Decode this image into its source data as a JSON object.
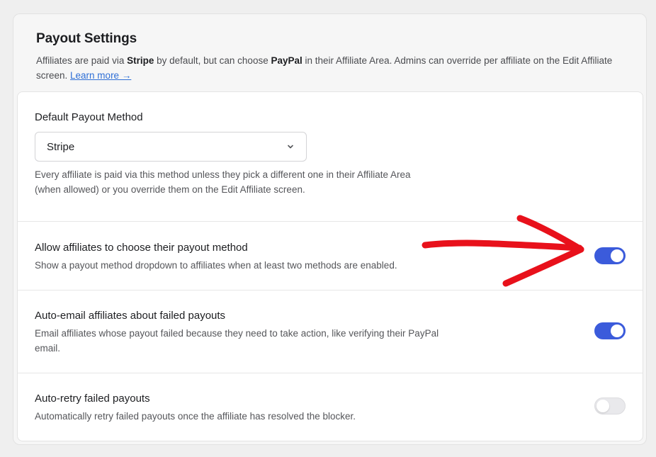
{
  "header": {
    "title": "Payout Settings",
    "desc_1": "Affiliates are paid via ",
    "desc_stripe": "Stripe",
    "desc_2": " by default, but can choose ",
    "desc_paypal": "PayPal",
    "desc_3": " in their Affiliate Area. Admins can override per affiliate on the Edit Affiliate screen. ",
    "learn_more": "Learn more →"
  },
  "default_method": {
    "label": "Default Payout Method",
    "selected": "Stripe",
    "help": "Every affiliate is paid via this method unless they pick a different one in their Affiliate Area (when allowed) or you override them on the Edit Affiliate screen."
  },
  "settings": [
    {
      "label": "Allow affiliates to choose their payout method",
      "help": "Show a payout method dropdown to affiliates when at least two methods are enabled.",
      "enabled": true
    },
    {
      "label": "Auto-email affiliates about failed payouts",
      "help": "Email affiliates whose payout failed because they need to take action, like verifying their PayPal email.",
      "enabled": true
    },
    {
      "label": "Auto-retry failed payouts",
      "help": "Automatically retry failed payouts once the affiliate has resolved the blocker.",
      "enabled": false
    }
  ],
  "colors": {
    "accent": "#3b5bdb",
    "annotation": "#e8111b",
    "link": "#2f6fd6"
  },
  "icons": {
    "select_chevron": "chevron-down-icon",
    "annotation": "red-arrow-annotation"
  }
}
